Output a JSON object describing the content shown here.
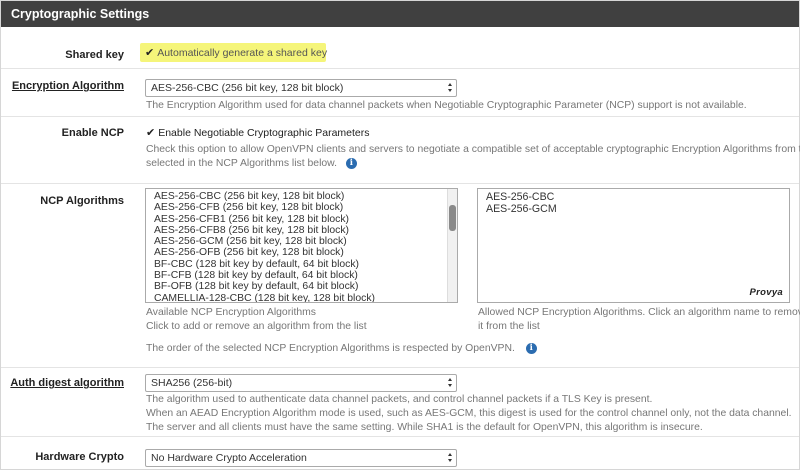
{
  "panel": {
    "title": "Cryptographic Settings"
  },
  "shared_key": {
    "label": "Shared key",
    "checkbox_label": "Automatically generate a shared key",
    "checked": true,
    "highlight_color": "#f5f57a"
  },
  "encryption": {
    "label": "Encryption Algorithm",
    "value": "AES-256-CBC (256 bit key, 128 bit block)",
    "help": "The Encryption Algorithm used for data channel packets when Negotiable Cryptographic Parameter (NCP) support is not available."
  },
  "enable_ncp": {
    "label": "Enable NCP",
    "checkbox_label": "Enable Negotiable Cryptographic Parameters",
    "checked": true,
    "help_line1": "Check this option to allow OpenVPN clients and servers to negotiate a compatible set of acceptable cryptographic Encryption Algorithms from those",
    "help_line2": "selected in the NCP Algorithms list below."
  },
  "ncp_algorithms": {
    "label": "NCP Algorithms",
    "available": [
      "AES-256-CBC (256 bit key, 128 bit block)",
      "AES-256-CFB (256 bit key, 128 bit block)",
      "AES-256-CFB1 (256 bit key, 128 bit block)",
      "AES-256-CFB8 (256 bit key, 128 bit block)",
      "AES-256-GCM (256 bit key, 128 bit block)",
      "AES-256-OFB (256 bit key, 128 bit block)",
      "BF-CBC (128 bit key by default, 64 bit block)",
      "BF-CFB (128 bit key by default, 64 bit block)",
      "BF-OFB (128 bit key by default, 64 bit block)",
      "CAMELLIA-128-CBC (128 bit key, 128 bit block)"
    ],
    "selected": [
      "AES-256-CBC",
      "AES-256-GCM"
    ],
    "available_help_line1": "Available NCP Encryption Algorithms",
    "available_help_line2": "Click to add or remove an algorithm from the list",
    "selected_help_line1": "Allowed NCP Encryption Algorithms. Click an algorithm name to remove",
    "selected_help_line2": "it from the list",
    "order_note": "The order of the selected NCP Encryption Algorithms is respected by OpenVPN.",
    "watermark": "Provya"
  },
  "auth_digest": {
    "label": "Auth digest algorithm",
    "value": "SHA256 (256-bit)",
    "help_line1": "The algorithm used to authenticate data channel packets, and control channel packets if a TLS Key is present.",
    "help_line2": "When an AEAD Encryption Algorithm mode is used, such as AES-GCM, this digest is used for the control channel only, not the data channel.",
    "help_line3": "The server and all clients must have the same setting. While SHA1 is the default for OpenVPN, this algorithm is insecure."
  },
  "hardware_crypto": {
    "label": "Hardware Crypto",
    "value": "No Hardware Crypto Acceleration"
  }
}
